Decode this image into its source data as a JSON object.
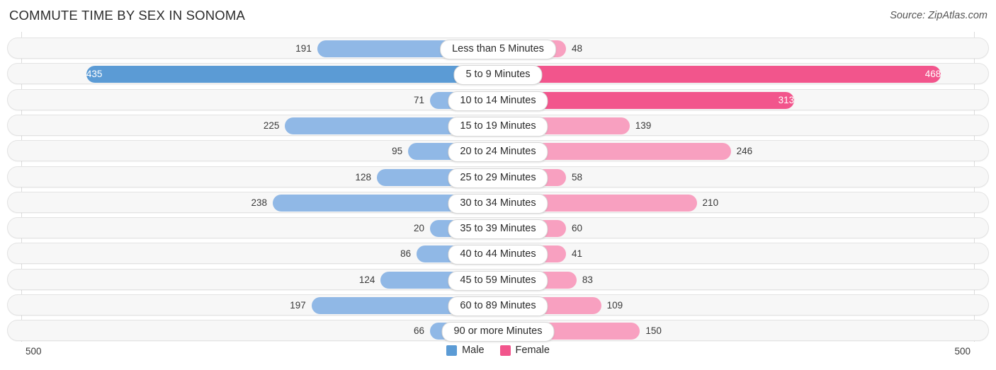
{
  "header": {
    "title": "COMMUTE TIME BY SEX IN SONOMA",
    "source": "Source: ZipAtlas.com"
  },
  "legend": {
    "male_label": "Male",
    "female_label": "Female",
    "male_color": "#5b9bd5",
    "female_color": "#f2558c"
  },
  "axis": {
    "left_max": "500",
    "right_max": "500"
  },
  "colors": {
    "male_strong": "#5b9bd5",
    "male_light": "#90b8e6",
    "female_strong": "#f2558c",
    "female_light": "#f8a0c0",
    "row_track": "#f7f7f7",
    "row_border": "#e3e3e3",
    "axis_line": "#dcdcdc"
  },
  "chart_data": {
    "type": "bar",
    "title": "COMMUTE TIME BY SEX IN SONOMA",
    "subtitle": "",
    "orientation": "horizontal-diverging",
    "xlabel": "",
    "ylabel": "",
    "axis_max": 500,
    "grid": false,
    "legend_position": "bottom-center",
    "categories": [
      "Less than 5 Minutes",
      "5 to 9 Minutes",
      "10 to 14 Minutes",
      "15 to 19 Minutes",
      "20 to 24 Minutes",
      "25 to 29 Minutes",
      "30 to 34 Minutes",
      "35 to 39 Minutes",
      "40 to 44 Minutes",
      "45 to 59 Minutes",
      "60 to 89 Minutes",
      "90 or more Minutes"
    ],
    "series": [
      {
        "name": "Male",
        "side": "left",
        "color": "#5b9bd5",
        "values": [
          191,
          435,
          71,
          225,
          95,
          128,
          238,
          20,
          86,
          124,
          197,
          66
        ]
      },
      {
        "name": "Female",
        "side": "right",
        "color": "#f2558c",
        "values": [
          48,
          468,
          313,
          139,
          246,
          58,
          210,
          60,
          41,
          83,
          109,
          150
        ]
      }
    ]
  },
  "rows": [
    {
      "category": "Less than 5 Minutes",
      "male": "191",
      "female": "48",
      "male_w": 191,
      "female_w": 48,
      "male_strong": false,
      "female_strong": false
    },
    {
      "category": "5 to 9 Minutes",
      "male": "435",
      "female": "468",
      "male_w": 435,
      "female_w": 468,
      "male_strong": true,
      "female_strong": true
    },
    {
      "category": "10 to 14 Minutes",
      "male": "71",
      "female": "313",
      "male_w": 71,
      "female_w": 313,
      "male_strong": false,
      "female_strong": true
    },
    {
      "category": "15 to 19 Minutes",
      "male": "225",
      "female": "139",
      "male_w": 225,
      "female_w": 139,
      "male_strong": false,
      "female_strong": false
    },
    {
      "category": "20 to 24 Minutes",
      "male": "95",
      "female": "246",
      "male_w": 95,
      "female_w": 246,
      "male_strong": false,
      "female_strong": false
    },
    {
      "category": "25 to 29 Minutes",
      "male": "128",
      "female": "58",
      "male_w": 128,
      "female_w": 58,
      "male_strong": false,
      "female_strong": false
    },
    {
      "category": "30 to 34 Minutes",
      "male": "238",
      "female": "210",
      "male_w": 238,
      "female_w": 210,
      "male_strong": false,
      "female_strong": false
    },
    {
      "category": "35 to 39 Minutes",
      "male": "20",
      "female": "60",
      "male_w": 20,
      "female_w": 60,
      "male_strong": false,
      "female_strong": false
    },
    {
      "category": "40 to 44 Minutes",
      "male": "86",
      "female": "41",
      "male_w": 86,
      "female_w": 41,
      "male_strong": false,
      "female_strong": false
    },
    {
      "category": "45 to 59 Minutes",
      "male": "124",
      "female": "83",
      "male_w": 124,
      "female_w": 83,
      "male_strong": false,
      "female_strong": false
    },
    {
      "category": "60 to 89 Minutes",
      "male": "197",
      "female": "109",
      "male_w": 197,
      "female_w": 109,
      "male_strong": false,
      "female_strong": false
    },
    {
      "category": "90 or more Minutes",
      "male": "66",
      "female": "150",
      "male_w": 66,
      "female_w": 150,
      "male_strong": false,
      "female_strong": false
    }
  ]
}
